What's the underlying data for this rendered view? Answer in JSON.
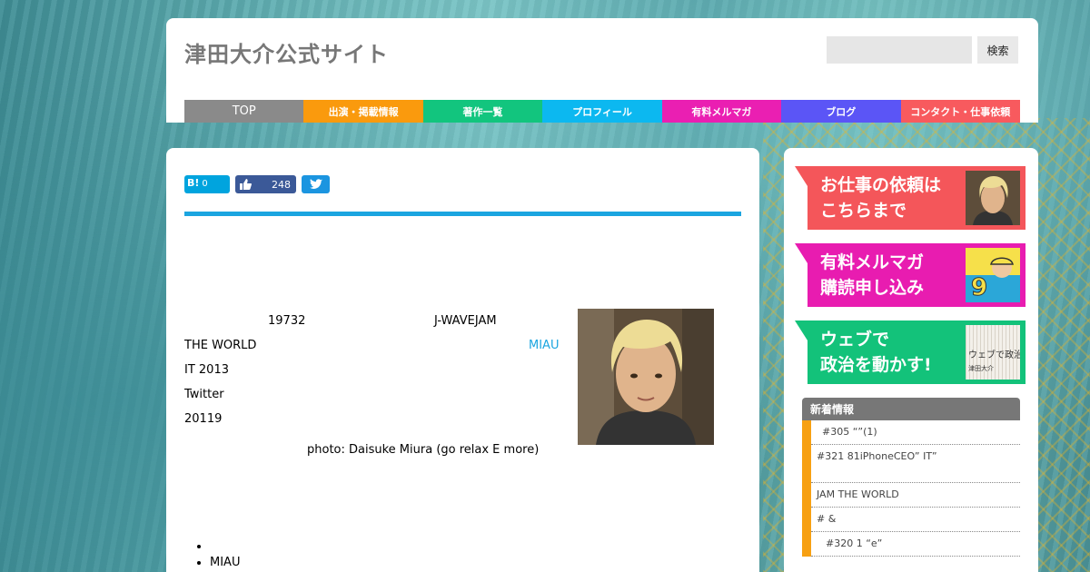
{
  "header": {
    "site_title": "津田大介公式サイト",
    "search_placeholder": "",
    "search_button": "検索"
  },
  "nav": [
    {
      "label": "TOP",
      "color": "#8a8a8a"
    },
    {
      "label": "出演・掲載情報",
      "color": "#fa9a0d"
    },
    {
      "label": "著作一覧",
      "color": "#12c57e"
    },
    {
      "label": "プロフィール",
      "color": "#0cb8f0"
    },
    {
      "label": "有料メルマガ",
      "color": "#ea1fb2"
    },
    {
      "label": "ブログ",
      "color": "#5b55f6"
    },
    {
      "label": "コンタクト・仕事依頼",
      "color": "#f85a5e"
    }
  ],
  "share": {
    "hatena_label": "B!",
    "hatena_count": "0",
    "facebook_count": "248"
  },
  "article": {
    "line1_a": "19732",
    "line1_b": "J-WAVEJAM",
    "line2_a": "THE WORLD",
    "line2_b": "MIAU",
    "line3": "IT 2013",
    "line4": "Twitter",
    "line5": "20119",
    "credit": "photo: Daisuke Miura (go relax E more)",
    "bullets": [
      "",
      "MIAU"
    ]
  },
  "sidebar": {
    "banners": [
      {
        "line1": "お仕事の依頼は",
        "line2": "こちらまで",
        "color": "#f4565a"
      },
      {
        "line1": "有料メルマガ",
        "line2": "購読申し込み",
        "color": "#e81cb0"
      },
      {
        "line1": "ウェブで",
        "line2": "政治を動かす!",
        "color": "#13c27a"
      }
    ],
    "book_title": "ウェブで政治",
    "book_author": "津田大介",
    "news_heading": "新着情報",
    "news": [
      "#305 “”(1)",
      "#321 81iPhoneCEO” IT”",
      "JAM THE WORLD",
      "# &",
      "#320 1 “e”"
    ]
  }
}
